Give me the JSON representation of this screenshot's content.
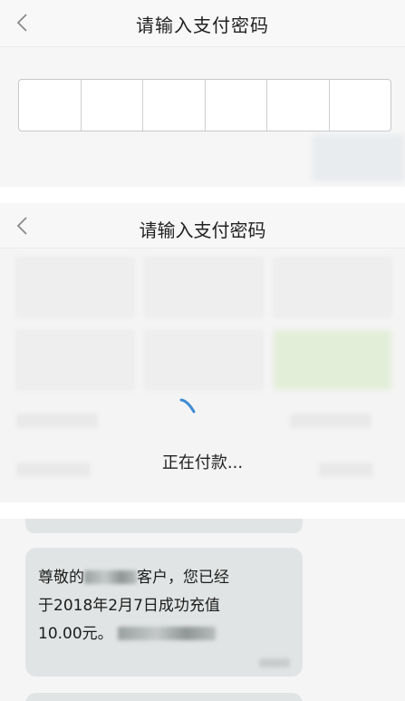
{
  "screen1": {
    "title": "请输入支付密码",
    "back_icon": "chevron-left-icon",
    "pin_length": 6
  },
  "screen2": {
    "title": "请输入支付密码",
    "back_icon": "chevron-left-icon",
    "status": "正在付款..."
  },
  "sms": {
    "message": "尊敬的",
    "message_mid": "客户，您已经",
    "message_line2": "于2018年2月7日成功充值",
    "message_line3": "10.00元。"
  },
  "colors": {
    "spinner": "#3f8bd6",
    "bubble": "#e1e4e4",
    "panel_bg": "#f4f4f4"
  }
}
